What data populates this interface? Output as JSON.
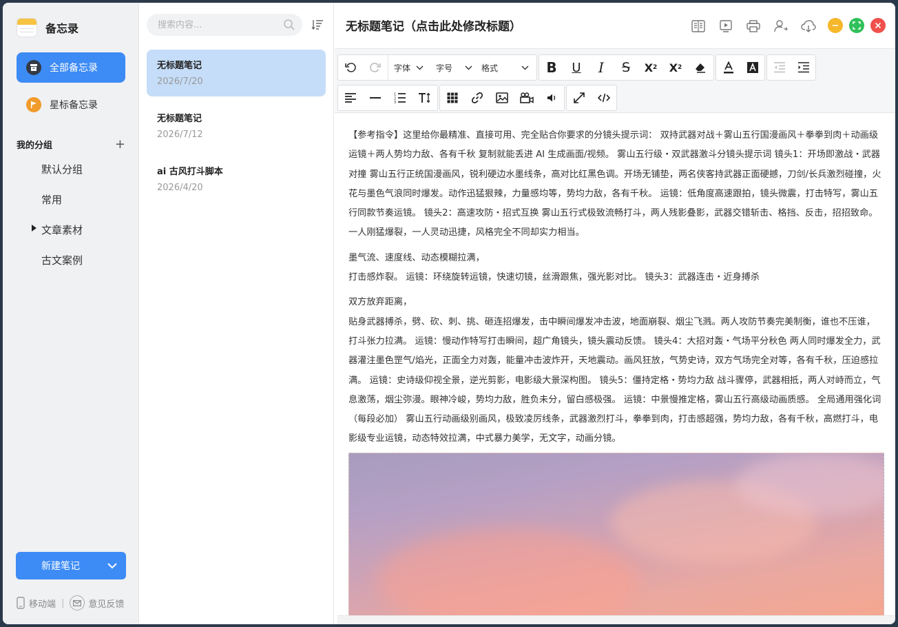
{
  "app": {
    "title": "备忘录"
  },
  "sidebar": {
    "all_label": "全部备忘录",
    "starred_label": "星标备忘录",
    "groups_title": "我的分组",
    "groups": [
      "默认分组",
      "常用",
      "文章素材",
      "古文案例"
    ],
    "new_note_label": "新建笔记",
    "mobile_label": "移动端",
    "feedback_label": "意见反馈",
    "accent_color": "#3d8bf5"
  },
  "notelist": {
    "search_placeholder": "搜索内容...",
    "notes": [
      {
        "title": "无标题笔记",
        "date": "2026/7/20",
        "active": true
      },
      {
        "title": "无标题笔记",
        "date": "2026/7/12",
        "active": false
      },
      {
        "title": "ai 古风打斗脚本",
        "date": "2026/4/20",
        "active": false
      }
    ]
  },
  "editor": {
    "title": "无标题笔记（点击此处修改标题）",
    "toolbar": {
      "font_label": "字体",
      "size_label": "字号",
      "format_label": "格式"
    },
    "paragraphs": [
      "【参考指令】这里给你最精准、直接可用、完全贴合你要求的分镜头提示词： 双持武器对战＋雾山五行国漫画风＋拳拳到肉＋动画级运镜＋两人势均力敌、各有千秋 复制就能丢进 AI 生成画面/视频。 雾山五行级・双武器激斗分镜头提示词 镜头1：开场即激战・武器对撞 雾山五行正统国漫画风，锐利硬边水墨线条，高对比红黑色调。开场无铺垫，两名侠客持武器正面硬撼，刀剑/长兵激烈碰撞，火花与墨色气浪同时爆发。动作迅猛狠辣，力量感均等，势均力敌，各有千秋。 运镜：低角度高速跟拍，镜头微震，打击特写，雾山五行同款节奏运镜。 镜头2：高速攻防・招式互换 雾山五行式极致流畅打斗，两人残影叠影，武器交错斩击、格挡、反击，招招致命。一人刚猛爆裂，一人灵动迅捷，风格完全不同却实力相当。",
      "墨气流、速度线、动态模糊拉满，\n打击感炸裂。 运镜：环绕旋转运镜，快速切镜，丝滑跟焦，强光影对比。 镜头3：武器连击・近身搏杀",
      "双方放弃距离，\n贴身武器搏杀，劈、砍、刺、挑、砸连招爆发，击中瞬间爆发冲击波，地面崩裂、烟尘飞溅。两人攻防节奏完美制衡，谁也不压谁，打斗张力拉满。 运镜：慢动作特写打击瞬间，超广角镜头，镜头震动反馈。 镜头4：大招对轰・气场平分秋色 两人同时爆发全力，武器灌注墨色罡气/焰光，正面全力对轰，能量冲击波炸开，天地震动。画风狂放，气势史诗，双方气场完全对等，各有千秋，压迫感拉满。 运镜：史诗级仰视全景，逆光剪影，电影级大景深构图。 镜头5：僵持定格・势均力敌 战斗骤停，武器相抵，两人对峙而立，气息激荡，烟尘弥漫。眼神冷峻，势均力敌，胜负未分，留白感极强。 运镜：中景慢推定格，雾山五行高级动画质感。 全局通用强化词（每段必加） 雾山五行动画级别画风，极致凌厉线条，武器激烈打斗，拳拳到肉，打击感超强，势均力敌，各有千秋，高燃打斗，电影级专业运镜，动态特效拉满，中式暴力美学，无文字，动画分镜。"
    ]
  }
}
